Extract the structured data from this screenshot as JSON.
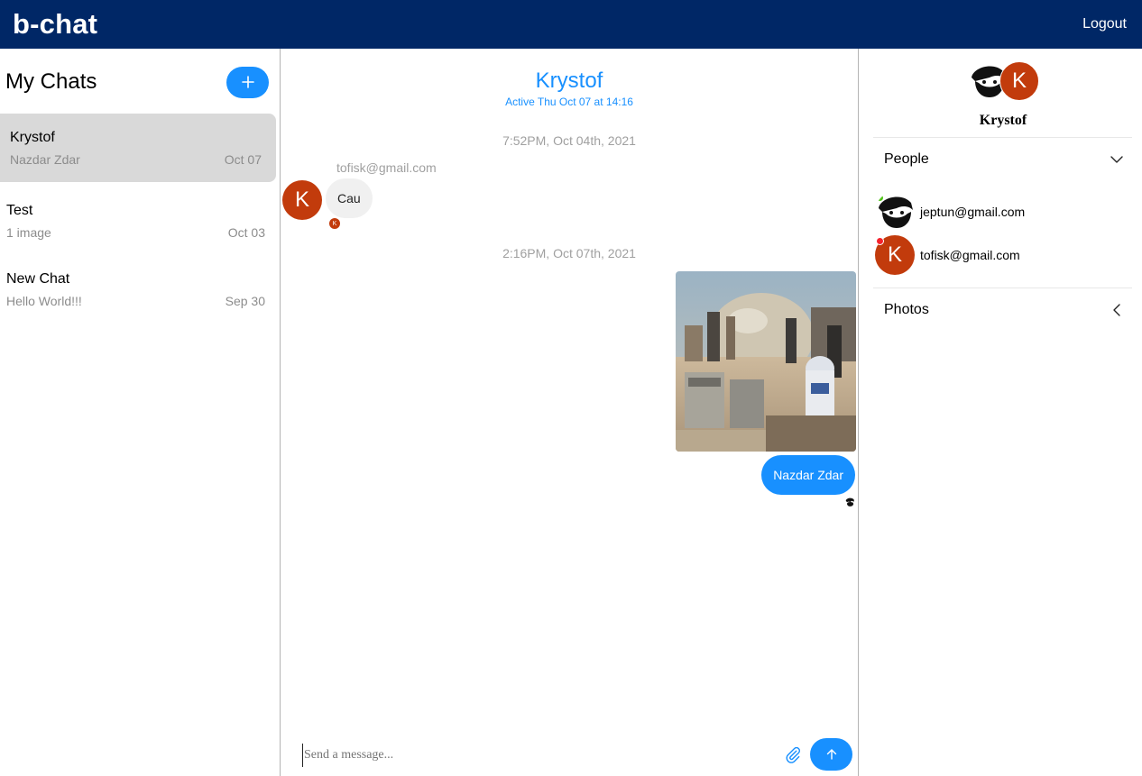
{
  "header": {
    "brand": "b-chat",
    "logout_label": "Logout",
    "background": "#002766"
  },
  "sidebar": {
    "title": "My Chats",
    "add_icon": "plus-icon",
    "chats": [
      {
        "name": "Krystof",
        "preview": "Nazdar Zdar",
        "date": "Oct 07",
        "active": true
      },
      {
        "name": "Test",
        "preview": "1 image",
        "date": "Oct 03",
        "active": false
      },
      {
        "name": "New Chat",
        "preview": "Hello World!!!",
        "date": "Sep 30",
        "active": false
      }
    ]
  },
  "conversation": {
    "title": "Krystof",
    "subtitle": "Active Thu Oct 07 at 14:16",
    "timestamps": [
      "7:52PM, Oct 04th, 2021",
      "2:16PM, Oct 07th, 2021"
    ],
    "incoming": {
      "sender": "tofisk@gmail.com",
      "avatar_letter": "K",
      "text": "Cau",
      "read_letter": "K"
    },
    "outgoing": {
      "photo_icon": "photo-image",
      "text": "Nazdar Zdar"
    },
    "composer": {
      "placeholder": "Send a message...",
      "attach_icon": "paperclip-icon",
      "send_icon": "arrow-up-icon"
    }
  },
  "details": {
    "group_letter": "K",
    "group_name": "Krystof",
    "people_label": "People",
    "people": [
      {
        "email": "jeptun@gmail.com",
        "status_color": "#52c41a",
        "avatar": "face-icon"
      },
      {
        "email": "tofisk@gmail.com",
        "status_color": "#f5222d",
        "avatar": "K"
      }
    ],
    "photos_label": "Photos"
  },
  "colors": {
    "accent": "#1890ff",
    "avatar_red": "#c23b0c",
    "online": "#52c41a",
    "offline": "#f5222d"
  }
}
